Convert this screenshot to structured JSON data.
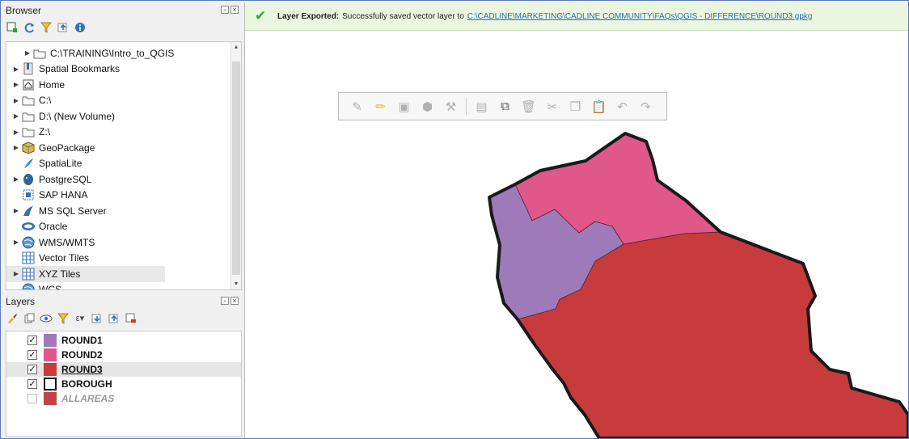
{
  "browser": {
    "title": "Browser",
    "items": [
      {
        "label": "C:\\TRAINING\\Intro_to_QGIS",
        "icon": "folder-icon",
        "expandable": true
      },
      {
        "label": "Spatial Bookmarks",
        "icon": "bookmark-icon",
        "expandable": true
      },
      {
        "label": "Home",
        "icon": "home-icon",
        "expandable": true
      },
      {
        "label": "C:\\",
        "icon": "drive-icon",
        "expandable": true
      },
      {
        "label": "D:\\ (New Volume)",
        "icon": "drive-icon",
        "expandable": true
      },
      {
        "label": "Z:\\",
        "icon": "drive-icon",
        "expandable": true
      },
      {
        "label": "GeoPackage",
        "icon": "geopackage-icon",
        "expandable": true
      },
      {
        "label": "SpatiaLite",
        "icon": "spatialite-icon",
        "expandable": false
      },
      {
        "label": "PostgreSQL",
        "icon": "postgresql-icon",
        "expandable": true
      },
      {
        "label": "SAP HANA",
        "icon": "hana-icon",
        "expandable": false
      },
      {
        "label": "MS SQL Server",
        "icon": "mssql-icon",
        "expandable": true
      },
      {
        "label": "Oracle",
        "icon": "oracle-icon",
        "expandable": false
      },
      {
        "label": "WMS/WMTS",
        "icon": "globe-icon",
        "expandable": true
      },
      {
        "label": "Vector Tiles",
        "icon": "grid-icon",
        "expandable": false
      },
      {
        "label": "XYZ Tiles",
        "icon": "grid-icon",
        "expandable": true
      },
      {
        "label": "WCS",
        "icon": "globe-icon",
        "expandable": false
      }
    ]
  },
  "layers": {
    "title": "Layers",
    "items": [
      {
        "name": "ROUND1",
        "checked": true,
        "color": "#9e7bb8",
        "selected": false
      },
      {
        "name": "ROUND2",
        "checked": true,
        "color": "#e0578a",
        "selected": false
      },
      {
        "name": "ROUND3",
        "checked": true,
        "color": "#c73b3c",
        "selected": true
      },
      {
        "name": "BOROUGH",
        "checked": true,
        "color": "#ffffff",
        "selected": false
      },
      {
        "name": "ALLAREAS",
        "checked": false,
        "color": "#c0454a",
        "selected": false
      }
    ]
  },
  "message": {
    "title": "Layer Exported:",
    "text": "Successfully saved vector layer to",
    "link": "C:\\CADLINE\\MARKETING\\CADLINE COMMUNITY\\FAQs\\QGIS - DIFFERENCE\\ROUND3.gpkg"
  },
  "colors": {
    "round1": "#9e7bb8",
    "round2": "#e0578a",
    "round3": "#c73b3c",
    "borough_outline": "#1a1a1a",
    "message_bg": "#eaf6e0",
    "link": "#2a6ebd"
  }
}
